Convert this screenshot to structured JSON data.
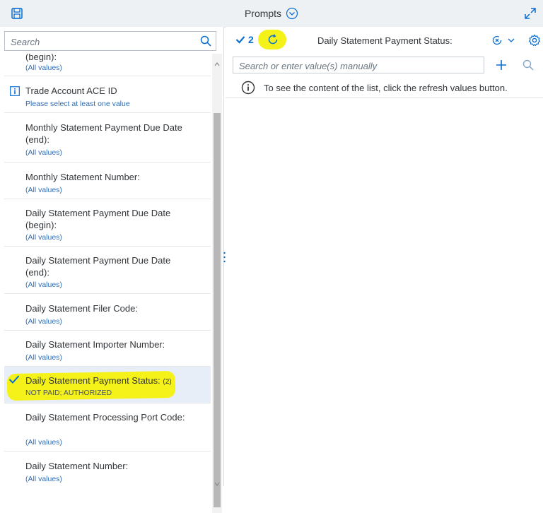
{
  "header": {
    "title": "Prompts"
  },
  "left_panel": {
    "search_placeholder": "Search",
    "items": [
      {
        "label": "(begin):",
        "sub": "(All values)"
      },
      {
        "label": "Trade Account ACE ID",
        "sub": "Please select at least one value",
        "icon": "info-icon"
      },
      {
        "label": "Monthly Statement Payment Due Date (end):",
        "sub": "(All values)"
      },
      {
        "label": "Monthly Statement Number:",
        "sub": "(All values)"
      },
      {
        "label": "Daily Statement Payment Due Date (begin):",
        "sub": "(All values)"
      },
      {
        "label": "Daily Statement Payment Due Date (end):",
        "sub": "(All values)"
      },
      {
        "label": "Daily Statement Filer Code:",
        "sub": "(All values)"
      },
      {
        "label": "Daily Statement Importer Number:",
        "sub": "(All values)"
      },
      {
        "label": "Daily Statement Payment Status:",
        "count": "(2)",
        "sub": "NOT PAID; AUTHORIZED",
        "selected": true,
        "icon": "checkmark-icon"
      },
      {
        "label": "Daily Statement Processing Port Code:",
        "sub": "(All values)"
      },
      {
        "label": "Daily Statement Number:",
        "sub": "(All values)"
      }
    ]
  },
  "right_panel": {
    "selected_count": "2",
    "title": "Daily Statement Payment Status:",
    "input_placeholder": "Search or enter value(s) manually",
    "info_text": "To see the content of the list, click the refresh values button."
  },
  "colors": {
    "accent": "#0a6ed1",
    "link": "#2f6db4",
    "highlight": "#f5f21a",
    "selected_row": "#e7eef7"
  }
}
